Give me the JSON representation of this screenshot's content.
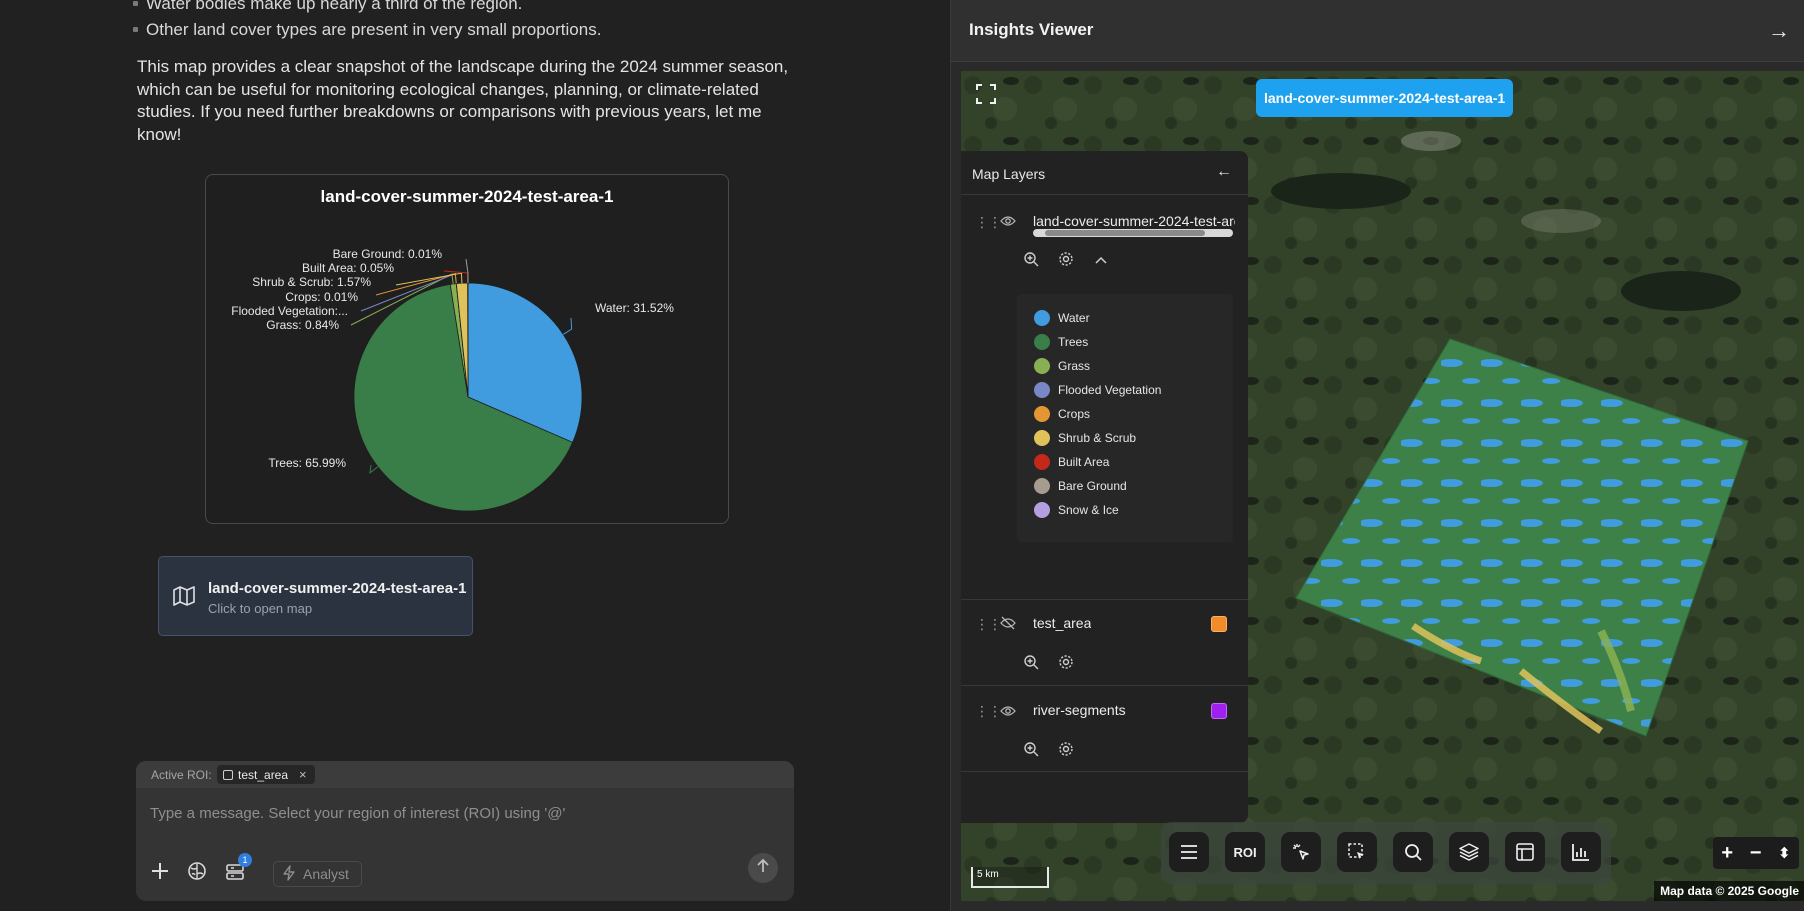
{
  "chat": {
    "bullets": [
      "Water bodies make up nearly a third of the region.",
      "Other land cover types are present in very small proportions."
    ],
    "paragraph": "This map provides a clear snapshot of the landscape during the 2024 summer season, which can be useful for monitoring ecological changes, planning, or climate-related studies. If you need further breakdowns or comparisons with previous years, let me know!",
    "map_card": {
      "title": "land-cover-summer-2024-test-area-1",
      "subtitle": "Click to open map",
      "icon": "map-icon"
    },
    "composer": {
      "roi_label": "Active ROI:",
      "roi_chip": "test_area",
      "roi_close": "×",
      "placeholder": "Type a message. Select your region of interest (ROI) using '@'",
      "badge_count": "1",
      "analyst_label": "Analyst",
      "icons": [
        "plus-icon",
        "brain-icon",
        "toolbox-icon",
        "bolt-icon",
        "send-arrow-icon"
      ]
    }
  },
  "chart_data": {
    "type": "pie",
    "title": "land-cover-summer-2024-test-area-1",
    "slices": [
      {
        "label": "Water",
        "value": 31.52,
        "display": "Water: 31.52%",
        "color": "#419bdf"
      },
      {
        "label": "Trees",
        "value": 65.99,
        "display": "Trees: 65.99%",
        "color": "#397d49"
      },
      {
        "label": "Grass",
        "value": 0.84,
        "display": "Grass: 0.84%",
        "color": "#88b053"
      },
      {
        "label": "Flooded Vegetation",
        "value": 0.01,
        "display": "Flooded Vegetation:...",
        "color": "#7a87c6"
      },
      {
        "label": "Crops",
        "value": 0.01,
        "display": "Crops: 0.01%",
        "color": "#e49635"
      },
      {
        "label": "Shrub & Scrub",
        "value": 1.57,
        "display": "Shrub & Scrub: 1.57%",
        "color": "#dfc35a"
      },
      {
        "label": "Built Area",
        "value": 0.05,
        "display": "Built Area: 0.05%",
        "color": "#c4281b"
      },
      {
        "label": "Bare Ground",
        "value": 0.01,
        "display": "Bare Ground: 0.01%",
        "color": "#a59b8f"
      }
    ]
  },
  "viewer": {
    "title": "Insights Viewer",
    "collapse_icon": "arrow-right-icon",
    "active_layer_chip": "land-cover-summer-2024-test-area-1",
    "layers_panel": {
      "title": "Map Layers",
      "layers": [
        {
          "name": "land-cover-summer-2024-test-area-1",
          "visible": true,
          "expanded": true
        },
        {
          "name": "test_area",
          "visible": false,
          "color": "#f28c28"
        },
        {
          "name": "river-segments",
          "visible": true,
          "color": "#a020f0"
        }
      ],
      "legend": [
        {
          "label": "Water",
          "color": "#419bdf"
        },
        {
          "label": "Trees",
          "color": "#397d49"
        },
        {
          "label": "Grass",
          "color": "#88b053"
        },
        {
          "label": "Flooded Vegetation",
          "color": "#7a87c6"
        },
        {
          "label": "Crops",
          "color": "#e49635"
        },
        {
          "label": "Shrub & Scrub",
          "color": "#dfc35a"
        },
        {
          "label": "Built Area",
          "color": "#c4281b"
        },
        {
          "label": "Bare Ground",
          "color": "#a59b8f"
        },
        {
          "label": "Snow & Ice",
          "color": "#b39fe1"
        }
      ]
    },
    "toolbar": {
      "roi_label": "ROI",
      "icons": [
        "menu-icon",
        "roi-button",
        "magic-select-icon",
        "box-select-icon",
        "search-icon",
        "layers-icon",
        "table-icon",
        "bar-chart-icon"
      ]
    },
    "zoom": {
      "in": "+",
      "out": "−",
      "compass": "⬍"
    },
    "scale_label": "5 km",
    "attribution": "Map data © 2025 Google"
  }
}
